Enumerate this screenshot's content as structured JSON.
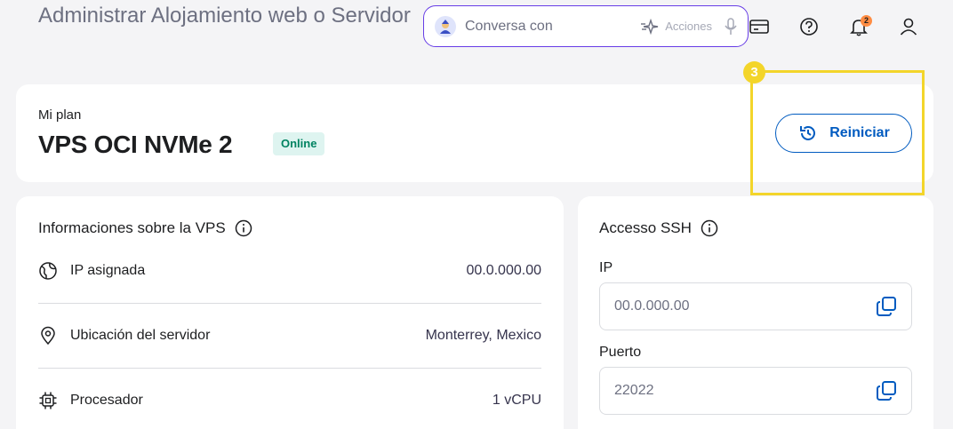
{
  "header": {
    "title": "Administrar Alojamiento web o Servidor",
    "chat": {
      "placeholder": "Conversa con",
      "actions_label": "Acciones"
    },
    "notifications_count": "2"
  },
  "plan": {
    "label": "Mi plan",
    "name": "VPS OCI NVMe 2",
    "status": "Online",
    "restart_label": "Reiniciar"
  },
  "tutorial": {
    "step": "3",
    "highlight_color": "#f3d52a"
  },
  "vps_info": {
    "title": "Informaciones sobre la VPS",
    "rows": [
      {
        "label": "IP asignada",
        "value": "00.0.000.00",
        "icon": "globe-icon"
      },
      {
        "label": "Ubicación del servidor",
        "value": "Monterrey, Mexico",
        "icon": "location-pin-icon"
      },
      {
        "label": "Procesador",
        "value": "1 vCPU",
        "icon": "cpu-icon"
      }
    ]
  },
  "ssh": {
    "title": "Accesso SSH",
    "ip_label": "IP",
    "ip_value": "00.0.000.00",
    "port_label": "Puerto",
    "port_value": "22022"
  },
  "colors": {
    "accent": "#673de6",
    "link": "#005bc0",
    "success": "#008361",
    "badge": "#ff8c42"
  }
}
